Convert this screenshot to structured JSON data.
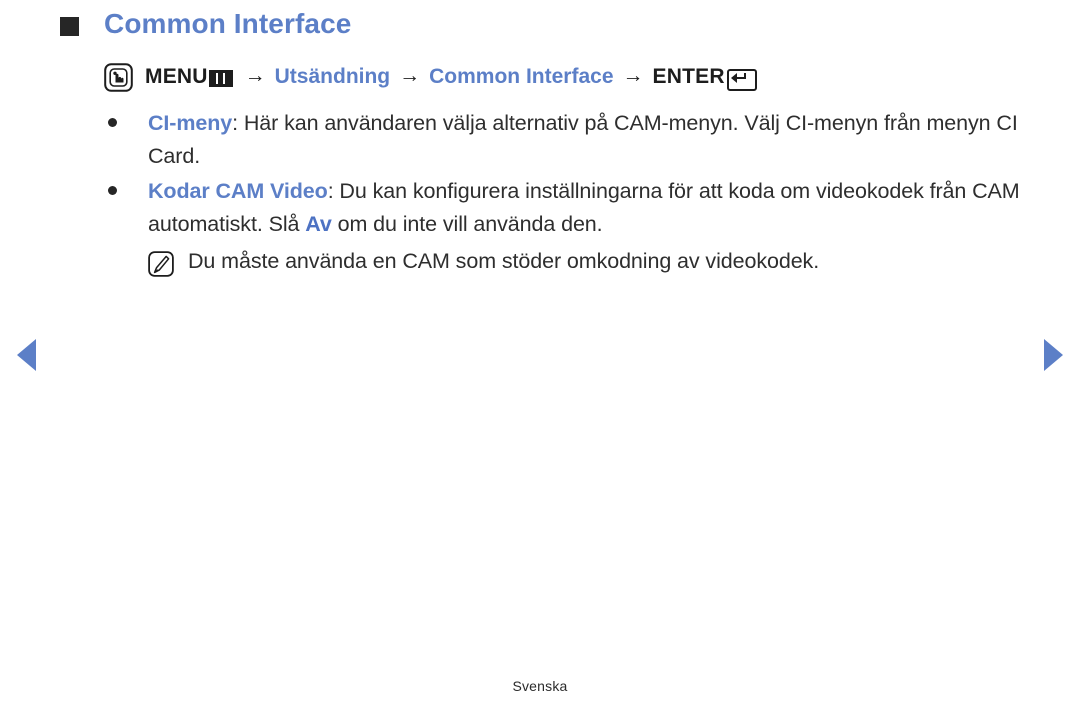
{
  "page": {
    "title": "Common Interface",
    "language_footer": "Svenska"
  },
  "menu_path": {
    "remote_icon": "touch-hand-icon",
    "menu_label": "MENU",
    "menu_glyph": "menu-grid-icon",
    "arrow": "→",
    "step_1": "Utsändning",
    "step_2": "Common Interface",
    "enter_label": "ENTER",
    "enter_glyph": "enter-return-icon"
  },
  "content": {
    "bullets": [
      {
        "term": "CI-meny",
        "separator": ":",
        "text": " Här kan användaren välja alternativ på CAM-menyn. Välj CI-menyn från menyn CI Card."
      },
      {
        "term": "Kodar CAM Video",
        "separator": ":",
        "text_before": " Du kan konfigurera inställningarna för att koda om videokodek från CAM automatiskt. Slå ",
        "highlight": "Av",
        "text_after": " om du inte vill använda den."
      }
    ],
    "note": {
      "icon": "note-pencil-icon",
      "text": "Du måste använda en CAM som stöder omkodning av videokodek."
    }
  },
  "navigation": {
    "prev_label": "previous-page",
    "next_label": "next-page"
  },
  "colors": {
    "accent_blue": "#5c7fc7",
    "highlight_blue": "#4d72c3",
    "body_text": "#2e2e2e",
    "bullet_dark": "#262626"
  }
}
